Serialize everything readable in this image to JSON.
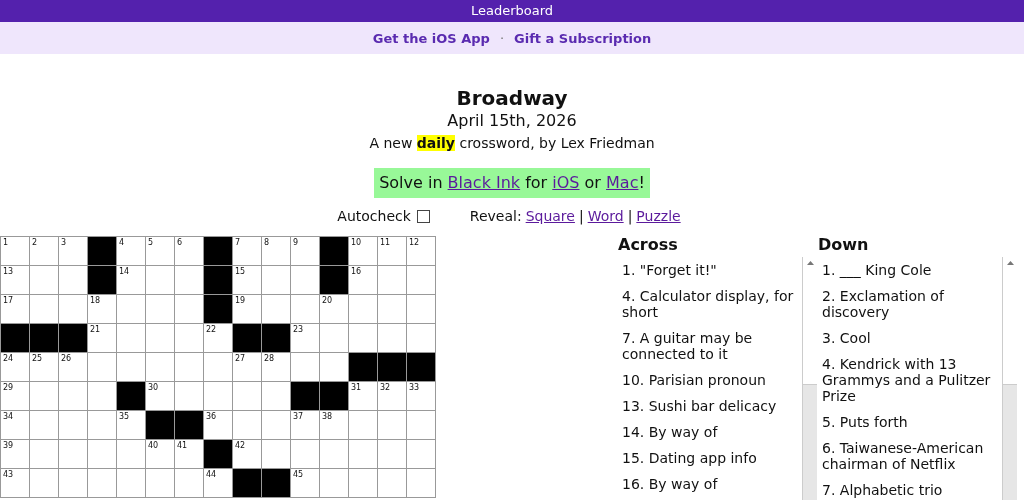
{
  "header": {
    "title": "Leaderboard"
  },
  "promo_links": [
    {
      "kind": "link",
      "text": "Get the iOS App"
    },
    {
      "kind": "separator",
      "text": "·"
    },
    {
      "kind": "link",
      "text": "Gift a Subscription"
    }
  ],
  "puzzle": {
    "title": "Broadway",
    "date": "April 15th, 2026",
    "byline": "A new **daily** crossword, by Lex Friedman"
  },
  "banner": {
    "parts": [
      {
        "kind": "text",
        "text": "Solve in "
      },
      {
        "kind": "link",
        "text": "Black Ink"
      },
      {
        "kind": "text",
        "text": " for "
      },
      {
        "kind": "link",
        "text": "iOS"
      },
      {
        "kind": "text",
        "text": " or "
      },
      {
        "kind": "link",
        "text": "Mac"
      },
      {
        "kind": "text",
        "text": "!"
      }
    ]
  },
  "autocheck": {
    "label": "Autocheck",
    "checked": false
  },
  "reveal": {
    "label": "Reveal:",
    "items": [
      {
        "kind": "link",
        "text": "Square"
      },
      {
        "kind": "separator",
        "text": "|"
      },
      {
        "kind": "link",
        "text": "Word"
      },
      {
        "kind": "separator",
        "text": "|"
      },
      {
        "kind": "link",
        "text": "Puzzle"
      }
    ]
  },
  "grid": {
    "rows": [
      [
        {
          "kind": "open",
          "number": "1"
        },
        {
          "kind": "open",
          "number": "2"
        },
        {
          "kind": "open",
          "number": "3"
        },
        {
          "kind": "block"
        },
        {
          "kind": "open",
          "number": "4"
        },
        {
          "kind": "open",
          "number": "5"
        },
        {
          "kind": "open",
          "number": "6"
        },
        {
          "kind": "block"
        },
        {
          "kind": "open",
          "number": "7"
        },
        {
          "kind": "open",
          "number": "8"
        },
        {
          "kind": "open",
          "number": "9"
        },
        {
          "kind": "block"
        },
        {
          "kind": "open",
          "number": "10"
        },
        {
          "kind": "open",
          "number": "11"
        },
        {
          "kind": "open",
          "number": "12"
        }
      ],
      [
        {
          "kind": "open",
          "number": "13"
        },
        {
          "kind": "open"
        },
        {
          "kind": "open"
        },
        {
          "kind": "block"
        },
        {
          "kind": "open",
          "number": "14"
        },
        {
          "kind": "open"
        },
        {
          "kind": "open"
        },
        {
          "kind": "block"
        },
        {
          "kind": "open",
          "number": "15"
        },
        {
          "kind": "open"
        },
        {
          "kind": "open"
        },
        {
          "kind": "block"
        },
        {
          "kind": "open",
          "number": "16"
        },
        {
          "kind": "open"
        },
        {
          "kind": "open"
        }
      ],
      [
        {
          "kind": "open",
          "number": "17"
        },
        {
          "kind": "open"
        },
        {
          "kind": "open"
        },
        {
          "kind": "open",
          "number": "18"
        },
        {
          "kind": "open"
        },
        {
          "kind": "open"
        },
        {
          "kind": "open"
        },
        {
          "kind": "block"
        },
        {
          "kind": "open",
          "number": "19"
        },
        {
          "kind": "open"
        },
        {
          "kind": "open"
        },
        {
          "kind": "open",
          "number": "20"
        },
        {
          "kind": "open"
        },
        {
          "kind": "open"
        },
        {
          "kind": "open"
        }
      ],
      [
        {
          "kind": "block"
        },
        {
          "kind": "block"
        },
        {
          "kind": "block"
        },
        {
          "kind": "open",
          "number": "21"
        },
        {
          "kind": "open"
        },
        {
          "kind": "open"
        },
        {
          "kind": "open"
        },
        {
          "kind": "open",
          "number": "22"
        },
        {
          "kind": "block"
        },
        {
          "kind": "block"
        },
        {
          "kind": "open",
          "number": "23"
        },
        {
          "kind": "open"
        },
        {
          "kind": "open"
        },
        {
          "kind": "open"
        },
        {
          "kind": "open"
        }
      ],
      [
        {
          "kind": "open",
          "number": "24"
        },
        {
          "kind": "open",
          "number": "25"
        },
        {
          "kind": "open",
          "number": "26"
        },
        {
          "kind": "open"
        },
        {
          "kind": "open"
        },
        {
          "kind": "open"
        },
        {
          "kind": "open"
        },
        {
          "kind": "open"
        },
        {
          "kind": "open",
          "number": "27"
        },
        {
          "kind": "open",
          "number": "28"
        },
        {
          "kind": "open"
        },
        {
          "kind": "open"
        },
        {
          "kind": "block"
        },
        {
          "kind": "block"
        },
        {
          "kind": "block"
        }
      ],
      [
        {
          "kind": "open",
          "number": "29"
        },
        {
          "kind": "open"
        },
        {
          "kind": "open"
        },
        {
          "kind": "open"
        },
        {
          "kind": "block"
        },
        {
          "kind": "open",
          "number": "30"
        },
        {
          "kind": "open"
        },
        {
          "kind": "open"
        },
        {
          "kind": "open"
        },
        {
          "kind": "open"
        },
        {
          "kind": "block"
        },
        {
          "kind": "block"
        },
        {
          "kind": "open",
          "number": "31"
        },
        {
          "kind": "open",
          "number": "32"
        },
        {
          "kind": "open",
          "number": "33"
        }
      ],
      [
        {
          "kind": "open",
          "number": "34"
        },
        {
          "kind": "open"
        },
        {
          "kind": "open"
        },
        {
          "kind": "open"
        },
        {
          "kind": "open",
          "number": "35"
        },
        {
          "kind": "block"
        },
        {
          "kind": "block"
        },
        {
          "kind": "open",
          "number": "36"
        },
        {
          "kind": "open"
        },
        {
          "kind": "open"
        },
        {
          "kind": "open",
          "number": "37"
        },
        {
          "kind": "open",
          "number": "38"
        },
        {
          "kind": "open"
        },
        {
          "kind": "open"
        },
        {
          "kind": "open"
        }
      ],
      [
        {
          "kind": "open",
          "number": "39"
        },
        {
          "kind": "open"
        },
        {
          "kind": "open"
        },
        {
          "kind": "open"
        },
        {
          "kind": "open"
        },
        {
          "kind": "open",
          "number": "40"
        },
        {
          "kind": "open",
          "number": "41"
        },
        {
          "kind": "block"
        },
        {
          "kind": "open",
          "number": "42"
        },
        {
          "kind": "open"
        },
        {
          "kind": "open"
        },
        {
          "kind": "open"
        },
        {
          "kind": "open"
        },
        {
          "kind": "open"
        },
        {
          "kind": "open"
        }
      ],
      [
        {
          "kind": "open",
          "number": "43"
        },
        {
          "kind": "open"
        },
        {
          "kind": "open"
        },
        {
          "kind": "open"
        },
        {
          "kind": "open"
        },
        {
          "kind": "open"
        },
        {
          "kind": "open"
        },
        {
          "kind": "open",
          "number": "44"
        },
        {
          "kind": "block"
        },
        {
          "kind": "block"
        },
        {
          "kind": "open",
          "number": "45"
        },
        {
          "kind": "open"
        },
        {
          "kind": "open"
        },
        {
          "kind": "open"
        },
        {
          "kind": "open"
        }
      ]
    ]
  },
  "clue_lists": [
    {
      "heading": "Across",
      "clues": [
        "1. \"Forget it!\"",
        "4. Calculator display, for short",
        "7. A guitar may be connected to it",
        "10. Parisian pronoun",
        "13. Sushi bar delicacy",
        "14. By way of",
        "15. Dating app info",
        "16. By way of"
      ]
    },
    {
      "heading": "Down",
      "clues": [
        "1. ___ King Cole",
        "2. Exclamation of discovery",
        "3. Cool",
        "4. Kendrick with 13 Grammys and a Pulitzer Prize",
        "5. Puts forth",
        "6. Taiwanese-American chairman of Netflix",
        "7. Alphabetic trio"
      ]
    }
  ]
}
